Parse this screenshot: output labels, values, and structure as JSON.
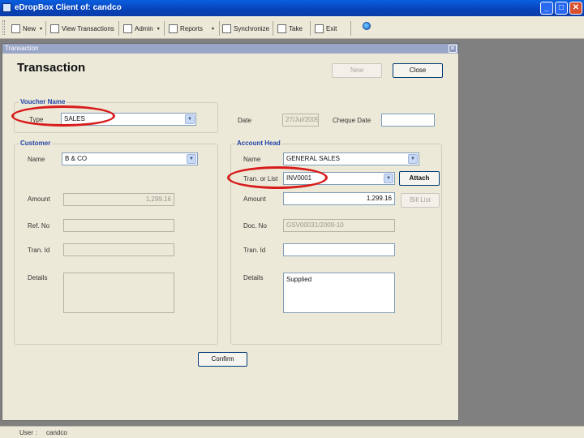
{
  "window": {
    "title": "eDropBox Client of: candco",
    "minimize": "_",
    "maximize": "□",
    "close": "✕"
  },
  "toolbar": {
    "new": "New",
    "view_transactions": "View Transactions",
    "admin": "Admin",
    "reports": "Reports",
    "synchronize": "Synchronize",
    "take": "Take",
    "exit": "Exit",
    "dropdown_caret": "▾"
  },
  "child_window": {
    "title": "Transaction",
    "close": "✕"
  },
  "form": {
    "heading": "Transaction",
    "new_button": "New",
    "close_button": "Close",
    "voucher": {
      "group_title": "Voucher Name",
      "type_label": "Type",
      "type_value": "SALES"
    },
    "date_label": "Date",
    "date_value": "27/Jul/2009",
    "cheque_date_label": "Cheque Date",
    "cheque_date_value": "",
    "customer": {
      "group_title": "Customer",
      "name_label": "Name",
      "name_value": "B & CO",
      "amount_label": "Amount",
      "amount_value": "1,299.16",
      "ref_no_label": "Ref. No",
      "ref_no_value": "",
      "tran_id_label": "Tran. Id",
      "tran_id_value": "",
      "details_label": "Details",
      "details_value": ""
    },
    "account_head": {
      "group_title": "Account Head",
      "name_label": "Name",
      "name_value": "GENERAL SALES",
      "tran_list_label": "Tran. or List",
      "tran_list_value": "INV0001",
      "attach_button": "Attach",
      "amount_label": "Amount",
      "amount_value": "1,299.16",
      "bill_list_button": "Bill List",
      "doc_no_label": "Doc. No",
      "doc_no_value": "GSV00031/2009-10",
      "tran_id_label": "Tran. Id",
      "tran_id_value": "",
      "details_label": "Details",
      "details_value": "Supplied"
    },
    "confirm_button": "Confirm",
    "combo_arrow": "▼"
  },
  "statusbar": {
    "user_label": "User",
    "separator": ":",
    "user_value": "candco"
  },
  "colors": {
    "annotation": "#d81c1c",
    "title_bar": "#0842b8",
    "group_title": "#2344a8"
  }
}
